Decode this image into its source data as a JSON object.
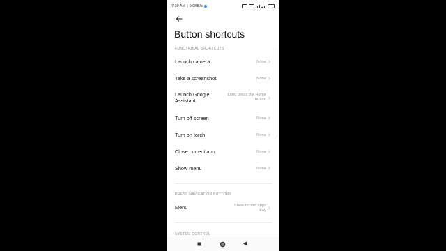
{
  "status_bar": {
    "time": "7:30 AM",
    "speed": "0.0KB/s"
  },
  "header": {
    "title": "Button shortcuts"
  },
  "functional_shortcuts": {
    "section_label": "FUNCTIONAL SHORTCUTS",
    "items": [
      {
        "label": "Launch camera",
        "value": "None"
      },
      {
        "label": "Take a screenshot",
        "value": "None"
      },
      {
        "label": "Launch Google Assistant",
        "value": "Long press the Home button"
      },
      {
        "label": "Turn off screen",
        "value": "None"
      },
      {
        "label": "Turn on torch",
        "value": "None"
      },
      {
        "label": "Close current app",
        "value": "None"
      },
      {
        "label": "Show menu",
        "value": "None"
      }
    ]
  },
  "navigation_buttons": {
    "section_label": "PRESS NAVIGATION BUTTONS",
    "items": [
      {
        "label": "Menu",
        "value": "Show recent apps tray"
      }
    ]
  },
  "system_control": {
    "section_label": "SYSTEM CONTROL"
  },
  "icons": {
    "back": "back-arrow-icon",
    "chevron": "chevron-right-icon",
    "nav_recents": "square-icon",
    "nav_home": "circle-icon",
    "nav_back": "triangle-icon"
  },
  "colors": {
    "background": "#ffffff",
    "text": "#141414",
    "secondary": "#9a9a9a",
    "status_accent": "#2b8ceb"
  }
}
